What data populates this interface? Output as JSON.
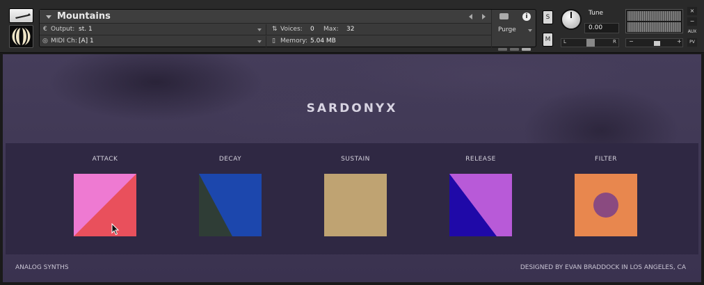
{
  "header": {
    "instrument_title": "Mountains",
    "output_label": "Output:",
    "output_value": "st. 1",
    "midi_label": "MIDI Ch:",
    "midi_value": "[A]  1",
    "voices_label": "Voices:",
    "voices_value": "0",
    "max_label": "Max:",
    "max_value": "32",
    "memory_label": "Memory:",
    "memory_value": "5.04 MB",
    "purge_label": "Purge",
    "info_label": "i",
    "solo_label": "S",
    "mute_label": "M",
    "tune_label": "Tune",
    "tune_value": "0.00",
    "pan_left": "L",
    "pan_right": "R",
    "vol_minus": "−",
    "vol_plus": "+",
    "close_label": "×",
    "minimize_label": "−",
    "aux_label": "AUX",
    "pv_label": "PV"
  },
  "instrument": {
    "brand": "SARDONYX",
    "footer_left": "ANALOG SYNTHS",
    "footer_right": "DESIGNED BY EVAN BRADDOCK IN LOS ANGELES, CA",
    "controls": [
      {
        "label": "ATTACK",
        "colors": [
          "#ee7ad2",
          "#e9505c"
        ]
      },
      {
        "label": "DECAY",
        "colors": [
          "#2f3d36",
          "#1c47ad"
        ]
      },
      {
        "label": "SUSTAIN",
        "colors": [
          "#bfa372"
        ]
      },
      {
        "label": "RELEASE",
        "colors": [
          "#1f09a8",
          "#b85ad8"
        ]
      },
      {
        "label": "FILTER",
        "colors": [
          "#e8874e",
          "#8a4a80"
        ]
      }
    ]
  },
  "colors": {
    "background": "#3b3350",
    "band": "#2f2843"
  }
}
